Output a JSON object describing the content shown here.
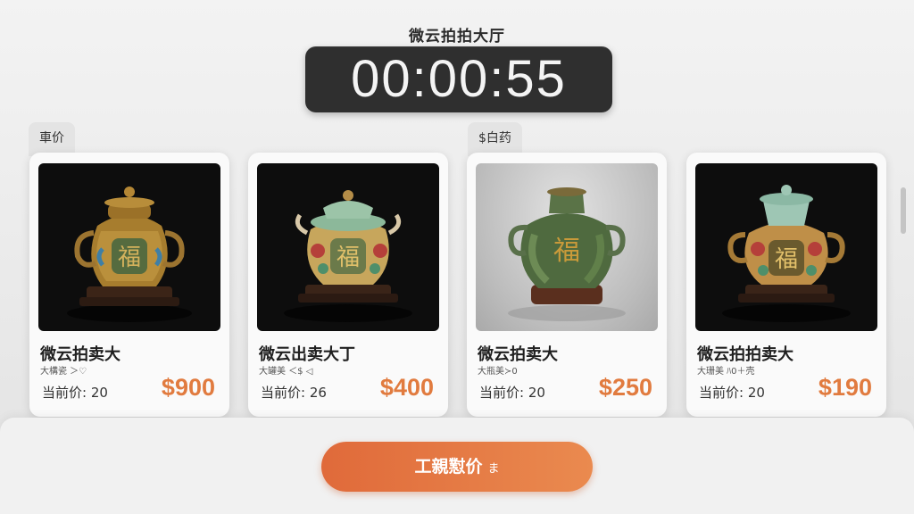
{
  "header": {
    "hall_title": "微云拍拍大厅",
    "countdown": "00:00:55"
  },
  "tabs": [
    {
      "label": "車价"
    },
    {
      "label": "$白药"
    }
  ],
  "lots": [
    {
      "name": "微云拍卖大",
      "subtitle": "大構瓷 ＞♡",
      "bid_label": "当前价: 20",
      "price": "$900",
      "image": "bronze-vase-with-handles"
    },
    {
      "name": "微云出卖大丁",
      "subtitle": "大罐美 ＜$ ◁",
      "bid_label": "当前价: 26",
      "price": "$400",
      "image": "enamel-lidded-jar"
    },
    {
      "name": "微云拍卖大",
      "subtitle": "大瓶美≻0",
      "bid_label": "当前价: 20",
      "price": "$250",
      "image": "green-glaze-vase"
    },
    {
      "name": "微云拍拍卖大",
      "subtitle": "大珊美 ﾊ0＋壳",
      "bid_label": "当前价: 20",
      "price": "$190",
      "image": "celadon-lidded-jar"
    }
  ],
  "action": {
    "bid_button_label": "工親懟价",
    "bid_button_icon": "hammer-icon",
    "hammer_glyph": "ま"
  },
  "colors": {
    "accent": "#e17b3f",
    "button_start": "#e06a3a",
    "button_end": "#ea8a4f",
    "timer_bg": "#2f2f2f"
  }
}
